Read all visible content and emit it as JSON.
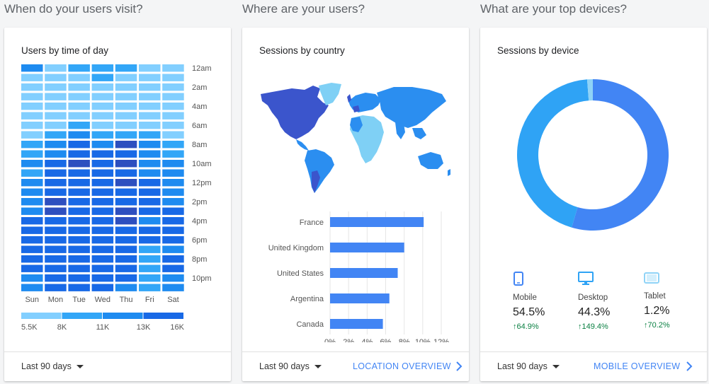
{
  "sections": {
    "time": "When do your users visit?",
    "location": "Where are your users?",
    "devices": "What are your top devices?"
  },
  "heatmap": {
    "title": "Users by time of day",
    "days": [
      "Sun",
      "Mon",
      "Tue",
      "Wed",
      "Thu",
      "Fri",
      "Sat"
    ],
    "hour_labels": [
      "12am",
      "2am",
      "4am",
      "6am",
      "8am",
      "10am",
      "12pm",
      "2pm",
      "4pm",
      "6pm",
      "8pm",
      "10pm"
    ],
    "legend": [
      "5.5K",
      "8K",
      "11K",
      "13K",
      "16K"
    ],
    "colors": [
      "#82cfff",
      "#32a6f7",
      "#1e8bf0",
      "#1869e6",
      "#2d4fbf"
    ],
    "levels": [
      [
        2,
        0,
        1,
        1,
        1,
        0,
        0
      ],
      [
        0,
        0,
        0,
        1,
        0,
        0,
        0
      ],
      [
        0,
        0,
        0,
        0,
        0,
        0,
        0
      ],
      [
        0,
        0,
        0,
        0,
        0,
        0,
        0
      ],
      [
        0,
        0,
        0,
        0,
        0,
        0,
        0
      ],
      [
        0,
        0,
        0,
        0,
        0,
        0,
        0
      ],
      [
        0,
        0,
        1,
        0,
        0,
        0,
        0
      ],
      [
        0,
        1,
        2,
        1,
        1,
        1,
        0
      ],
      [
        1,
        2,
        3,
        2,
        4,
        2,
        1
      ],
      [
        1,
        2,
        3,
        3,
        3,
        2,
        1
      ],
      [
        2,
        3,
        4,
        3,
        4,
        2,
        2
      ],
      [
        1,
        3,
        3,
        3,
        3,
        2,
        2
      ],
      [
        2,
        3,
        3,
        3,
        4,
        3,
        2
      ],
      [
        2,
        3,
        3,
        3,
        3,
        3,
        2
      ],
      [
        2,
        4,
        3,
        3,
        3,
        3,
        2
      ],
      [
        2,
        4,
        3,
        3,
        4,
        3,
        3
      ],
      [
        3,
        3,
        3,
        3,
        4,
        2,
        3
      ],
      [
        3,
        3,
        3,
        3,
        3,
        3,
        3
      ],
      [
        3,
        3,
        3,
        3,
        3,
        3,
        3
      ],
      [
        3,
        3,
        3,
        3,
        3,
        1,
        2
      ],
      [
        3,
        3,
        3,
        3,
        3,
        1,
        3
      ],
      [
        3,
        3,
        3,
        3,
        3,
        1,
        3
      ],
      [
        2,
        3,
        3,
        3,
        3,
        1,
        2
      ],
      [
        2,
        3,
        3,
        3,
        2,
        1,
        2
      ]
    ],
    "range": "Last 90 days"
  },
  "location": {
    "title": "Sessions by country",
    "range": "Last 90 days",
    "overview": "LOCATION OVERVIEW",
    "colors": {
      "dark": "#3b55cc",
      "mid": "#2b8ef0",
      "light": "#7fd0f5",
      "bar": "#4285f4"
    }
  },
  "chart_data": {
    "type": "bar",
    "orientation": "horizontal",
    "categories": [
      "France",
      "United Kingdom",
      "United States",
      "Argentina",
      "Canada"
    ],
    "values": [
      10.1,
      8.0,
      7.3,
      6.4,
      5.7
    ],
    "xticks": [
      "0%",
      "2%",
      "4%",
      "6%",
      "8%",
      "10%",
      "12%"
    ],
    "xlim": [
      0,
      12
    ]
  },
  "devices": {
    "title": "Sessions by device",
    "range": "Last 90 days",
    "overview": "MOBILE OVERVIEW",
    "colors": {
      "mobile": "#4285f4",
      "desktop": "#2fa3f5",
      "tablet": "#8fd3f7"
    },
    "items": [
      {
        "name": "Mobile",
        "pct": "54.5%",
        "share": 54.5,
        "delta": "↑64.9%"
      },
      {
        "name": "Desktop",
        "pct": "44.3%",
        "share": 44.3,
        "delta": "↑149.4%"
      },
      {
        "name": "Tablet",
        "pct": "1.2%",
        "share": 1.2,
        "delta": "↑70.2%"
      }
    ]
  }
}
